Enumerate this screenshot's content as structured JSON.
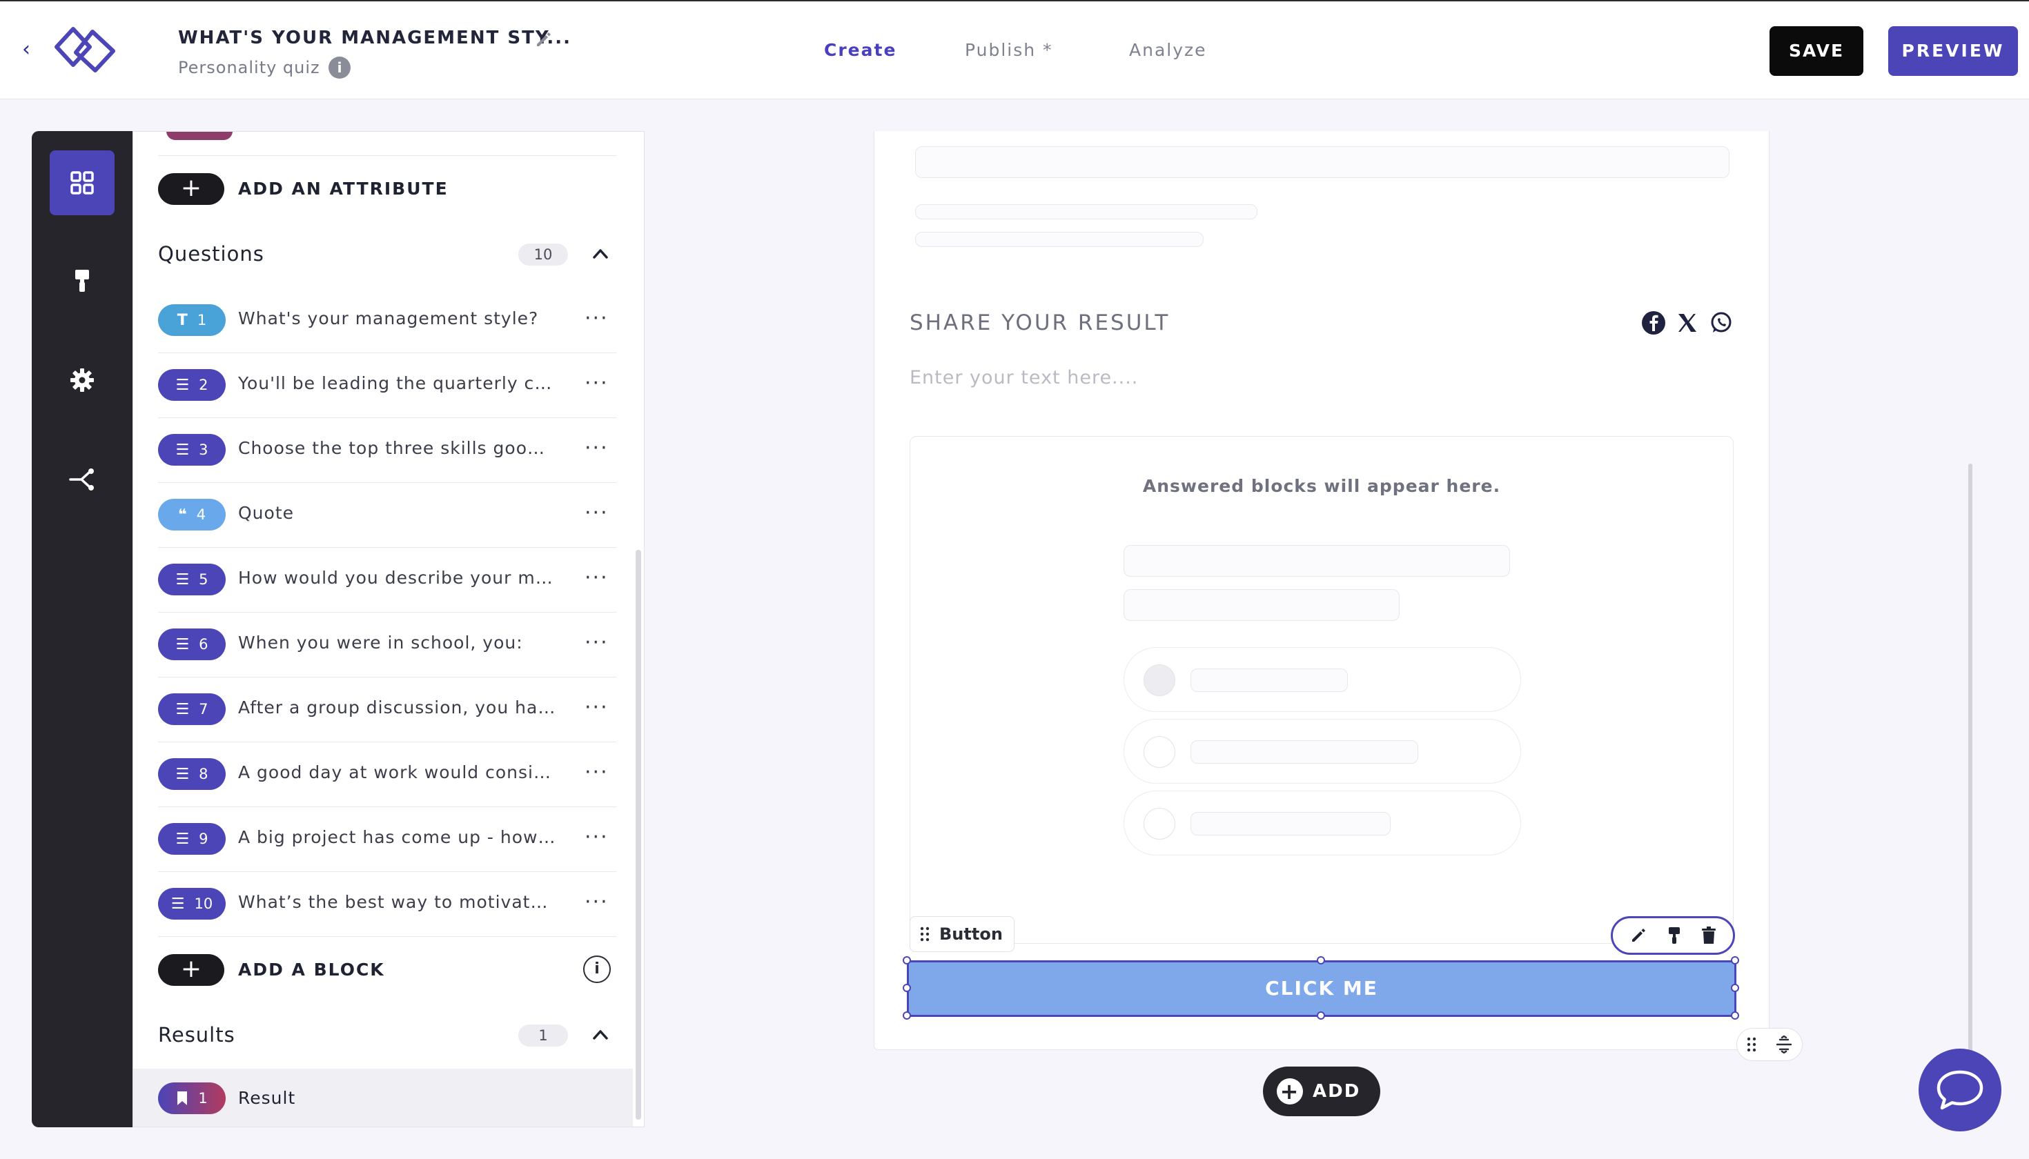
{
  "header": {
    "quiz_title": "WHAT'S YOUR MANAGEMENT STY...",
    "quiz_type": "Personality quiz",
    "info_glyph": "i",
    "tabs": [
      {
        "label": "Create",
        "active": true
      },
      {
        "label": "Publish *",
        "active": false
      },
      {
        "label": "Analyze",
        "active": false
      }
    ],
    "save_label": "SAVE",
    "preview_label": "PREVIEW"
  },
  "rail": {
    "items": [
      {
        "icon": "grid-icon",
        "active": true
      },
      {
        "icon": "paint-roller-icon",
        "active": false
      },
      {
        "icon": "gear-icon",
        "active": false
      },
      {
        "icon": "branch-icon",
        "active": false
      }
    ]
  },
  "panel": {
    "add_attribute_label": "ADD AN ATTRIBUTE",
    "plus_glyph": "+",
    "questions_title": "Questions",
    "questions_count": "10",
    "questions": [
      {
        "num": "1",
        "type": "text",
        "glyph": "T",
        "label": "What's your management style?",
        "color": "#4aa3d8"
      },
      {
        "num": "2",
        "type": "list",
        "glyph": "☰",
        "label": "You'll be leading the quarterly com...",
        "color": "#4b45b7"
      },
      {
        "num": "3",
        "type": "list",
        "glyph": "☰",
        "label": "Choose the top three skills good m...",
        "color": "#4b45b7"
      },
      {
        "num": "4",
        "type": "quote",
        "glyph": "❝",
        "label": "Quote",
        "color": "#6aa8ec"
      },
      {
        "num": "5",
        "type": "list",
        "glyph": "☰",
        "label": "How would you describe your man...",
        "color": "#4b45b7"
      },
      {
        "num": "6",
        "type": "list",
        "glyph": "☰",
        "label": "When you were in school, you:",
        "color": "#4b45b7"
      },
      {
        "num": "7",
        "type": "list",
        "glyph": "☰",
        "label": "After a group discussion, you have...",
        "color": "#4b45b7"
      },
      {
        "num": "8",
        "type": "list",
        "glyph": "☰",
        "label": "A good day at work would consist ...",
        "color": "#4b45b7"
      },
      {
        "num": "9",
        "type": "list",
        "glyph": "☰",
        "label": "A big project has come up - how d...",
        "color": "#4b45b7"
      },
      {
        "num": "10",
        "type": "list",
        "glyph": "☰",
        "label": "What’s the best way to motivate yo...",
        "color": "#4b45b7"
      }
    ],
    "add_block_label": "ADD A BLOCK",
    "block_info_glyph": "i",
    "results_title": "Results",
    "results_count": "1",
    "results": [
      {
        "num": "1",
        "label": "Result"
      }
    ]
  },
  "canvas": {
    "share_title": "SHARE YOUR RESULT",
    "share_placeholder": "Enter your text here....",
    "answered_text": "Answered blocks will appear here.",
    "button_tag_label": "Button",
    "cta_label": "CLICK ME",
    "add_label": "ADD",
    "add_glyph": "+"
  },
  "colors": {
    "accent": "#4b45b7",
    "cta_fill": "#7ea8ea",
    "dark": "#25252b"
  }
}
